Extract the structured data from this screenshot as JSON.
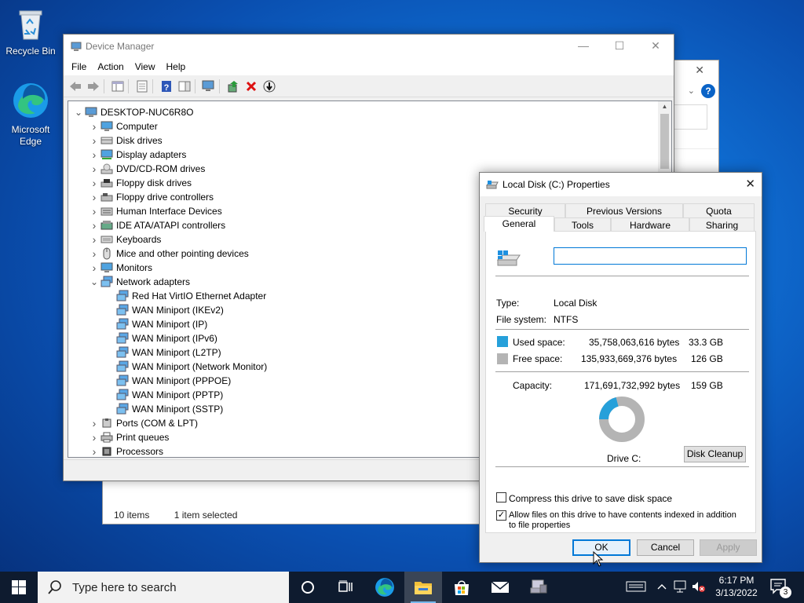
{
  "desktop": {
    "icons": [
      {
        "label": "Recycle Bin"
      },
      {
        "label": "Microsoft Edge"
      }
    ]
  },
  "background_window": {
    "close": "✕",
    "status_items": "10 items",
    "status_selected": "1 item selected"
  },
  "device_manager": {
    "title": "Device Manager",
    "menu": [
      "File",
      "Action",
      "View",
      "Help"
    ],
    "tree": [
      {
        "label": "DESKTOP-NUC6R8O",
        "level": 0,
        "expanded": true,
        "icon": "computer-root-icon"
      },
      {
        "label": "Computer",
        "level": 1,
        "icon": "monitor-icon"
      },
      {
        "label": "Disk drives",
        "level": 1,
        "icon": "disk-drive-icon"
      },
      {
        "label": "Display adapters",
        "level": 1,
        "icon": "display-adapter-icon"
      },
      {
        "label": "DVD/CD-ROM drives",
        "level": 1,
        "icon": "dvd-drive-icon"
      },
      {
        "label": "Floppy disk drives",
        "level": 1,
        "icon": "floppy-icon"
      },
      {
        "label": "Floppy drive controllers",
        "level": 1,
        "icon": "controller-icon"
      },
      {
        "label": "Human Interface Devices",
        "level": 1,
        "icon": "hid-icon"
      },
      {
        "label": "IDE ATA/ATAPI controllers",
        "level": 1,
        "icon": "ide-controller-icon"
      },
      {
        "label": "Keyboards",
        "level": 1,
        "icon": "keyboard-icon"
      },
      {
        "label": "Mice and other pointing devices",
        "level": 1,
        "icon": "mouse-icon"
      },
      {
        "label": "Monitors",
        "level": 1,
        "icon": "monitor-icon"
      },
      {
        "label": "Network adapters",
        "level": 1,
        "expanded": true,
        "icon": "network-adapter-icon"
      },
      {
        "label": "Red Hat VirtIO Ethernet Adapter",
        "level": 2,
        "icon": "network-adapter-icon"
      },
      {
        "label": "WAN Miniport (IKEv2)",
        "level": 2,
        "icon": "network-adapter-icon"
      },
      {
        "label": "WAN Miniport (IP)",
        "level": 2,
        "icon": "network-adapter-icon"
      },
      {
        "label": "WAN Miniport (IPv6)",
        "level": 2,
        "icon": "network-adapter-icon"
      },
      {
        "label": "WAN Miniport (L2TP)",
        "level": 2,
        "icon": "network-adapter-icon"
      },
      {
        "label": "WAN Miniport (Network Monitor)",
        "level": 2,
        "icon": "network-adapter-icon"
      },
      {
        "label": "WAN Miniport (PPPOE)",
        "level": 2,
        "icon": "network-adapter-icon"
      },
      {
        "label": "WAN Miniport (PPTP)",
        "level": 2,
        "icon": "network-adapter-icon"
      },
      {
        "label": "WAN Miniport (SSTP)",
        "level": 2,
        "icon": "network-adapter-icon"
      },
      {
        "label": "Ports (COM & LPT)",
        "level": 1,
        "icon": "port-icon"
      },
      {
        "label": "Print queues",
        "level": 1,
        "icon": "printer-icon"
      },
      {
        "label": "Processors",
        "level": 1,
        "icon": "processor-icon"
      }
    ]
  },
  "properties": {
    "title": "Local Disk (C:) Properties",
    "tabs_top": [
      "Security",
      "Previous Versions",
      "Quota"
    ],
    "tabs_bottom": [
      "General",
      "Tools",
      "Hardware",
      "Sharing"
    ],
    "active_tab": "General",
    "volume_name": "",
    "type_label": "Type:",
    "type_value": "Local Disk",
    "fs_label": "File system:",
    "fs_value": "NTFS",
    "used_label": "Used space:",
    "used_bytes": "35,758,063,616 bytes",
    "used_gb": "33.3 GB",
    "free_label": "Free space:",
    "free_bytes": "135,933,669,376 bytes",
    "free_gb": "126 GB",
    "capacity_label": "Capacity:",
    "capacity_bytes": "171,691,732,992 bytes",
    "capacity_gb": "159 GB",
    "used_fraction": 0.208,
    "used_color": "#26a0da",
    "free_color": "#b4b4b4",
    "drive_label": "Drive C:",
    "disk_cleanup": "Disk Cleanup",
    "compress_label": "Compress this drive to save disk space",
    "compress_checked": false,
    "index_label": "Allow files on this drive to have contents indexed in addition to file properties",
    "index_checked": true,
    "ok": "OK",
    "cancel": "Cancel",
    "apply": "Apply"
  },
  "taskbar": {
    "search_placeholder": "Type here to search",
    "time": "6:17 PM",
    "date": "3/13/2022",
    "notification_count": "3"
  }
}
